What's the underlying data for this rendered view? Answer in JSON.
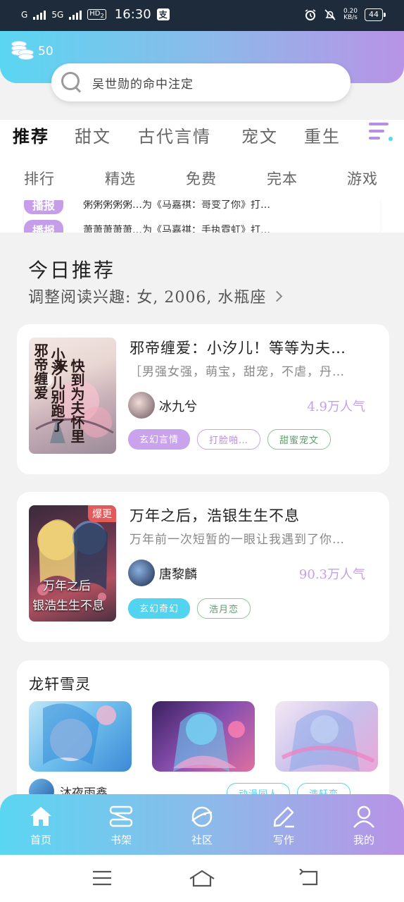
{
  "status_bar": {
    "network_left": "G",
    "network_5g": "5G",
    "hd": "HD",
    "hd_sub": "2",
    "time": "16:30",
    "app_icon_char": "支",
    "net_speed_value": "0.20",
    "net_speed_unit": "KB/s",
    "battery": "44"
  },
  "header": {
    "coins": "50",
    "search_placeholder": "吴世勋的命中注定"
  },
  "category_tabs": [
    {
      "label": "推荐",
      "active": true
    },
    {
      "label": "甜文",
      "active": false
    },
    {
      "label": "古代言情",
      "active": false
    },
    {
      "label": "宠文",
      "active": false
    },
    {
      "label": "重生",
      "active": false
    }
  ],
  "sub_tabs": [
    "排行",
    "精选",
    "免费",
    "完本",
    "游戏"
  ],
  "notice": [
    {
      "tag": "播报",
      "text": "粥粥粥粥粥…为《马嘉祺：哥变了你》打…"
    },
    {
      "tag": "播报",
      "text": "萧萧萧萧萧…为《马嘉祺：手执霓虹》打…"
    }
  ],
  "today": {
    "title": "今日推荐",
    "interest_text": "调整阅读兴趣: 女, 2006, 水瓶座"
  },
  "books": [
    {
      "cover_title_lines": [
        "邪帝缠爱",
        "小汐儿别跑了",
        "快到为夫怀里来"
      ],
      "cover_badge": "",
      "title": "邪帝缠爱：小汐儿！等等为夫…",
      "desc": "［男强女强，萌宝，甜宠，不虐，丹…",
      "author": "冰九兮",
      "popularity": "4.9万人气",
      "tags": [
        {
          "label": "玄幻言情",
          "style": "purple-fill"
        },
        {
          "label": "打脸啪…",
          "style": "purple-outline"
        },
        {
          "label": "甜蜜宠文",
          "style": "green-outline"
        }
      ]
    },
    {
      "cover_title_lines": [
        "万年之后",
        "银浩生生不息"
      ],
      "cover_badge": "爆更",
      "title": "万年之后，浩银生生不息",
      "desc": "万年前一次短暂的一眼让我遇到了你…",
      "author": "唐黎麟",
      "popularity": "90.3万人气",
      "tags": [
        {
          "label": "玄幻奇幻",
          "style": "cyan-fill"
        },
        {
          "label": "浩月恋",
          "style": "green-outline"
        }
      ]
    }
  ],
  "showcase": {
    "title": "龙轩雪灵",
    "user": "沐夜雨鑫",
    "tags": [
      "动漫同人",
      "浩轩恋"
    ]
  },
  "bottom_nav": [
    {
      "label": "首页",
      "icon": "home-icon"
    },
    {
      "label": "书架",
      "icon": "bookshelf-icon"
    },
    {
      "label": "社区",
      "icon": "planet-icon"
    },
    {
      "label": "写作",
      "icon": "pen-icon"
    },
    {
      "label": "我的",
      "icon": "user-icon"
    }
  ],
  "colors": {
    "gradient_start": "#5ad6f2",
    "gradient_end": "#b893e6",
    "accent_purple": "#c598e6",
    "accent_cyan": "#52d3f0"
  }
}
